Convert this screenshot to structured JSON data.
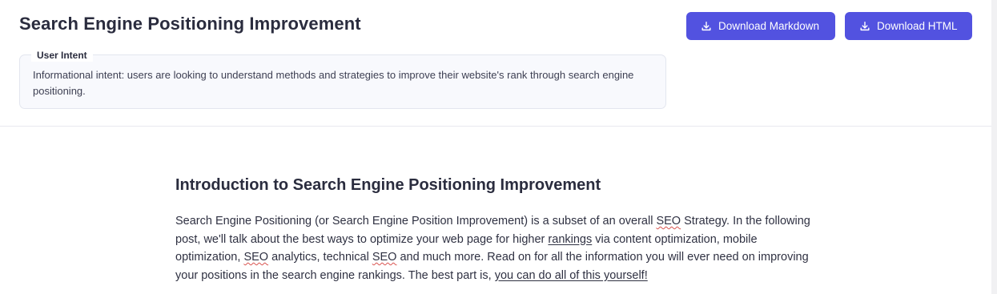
{
  "header": {
    "title": "Search Engine Positioning Improvement",
    "download_markdown_label": "Download Markdown",
    "download_html_label": "Download HTML",
    "accent_color": "#5252e0"
  },
  "intent": {
    "label": "User Intent",
    "text": "Informational intent: users are looking to understand methods and strategies to improve their website's rank through search engine positioning."
  },
  "article": {
    "heading": "Introduction to Search Engine Positioning Improvement",
    "p1": {
      "t1": "Search Engine Positioning (or Search Engine Position Improvement) is a subset of an overall ",
      "seo1": "SEO",
      "t2": " Strategy. In the following post, we'll talk about the best ways to optimize your web page for higher ",
      "link_rankings": "rankings",
      "t3": " via content optimization, mobile optimization, ",
      "seo2": "SEO",
      "t4": " analytics, technical ",
      "seo3": "SEO",
      "t5": " and much more. Read on for all the information you will ever need on improving your positions in the search engine rankings. The best part is, ",
      "link_yourself": "you can do all of this yourself!"
    }
  }
}
